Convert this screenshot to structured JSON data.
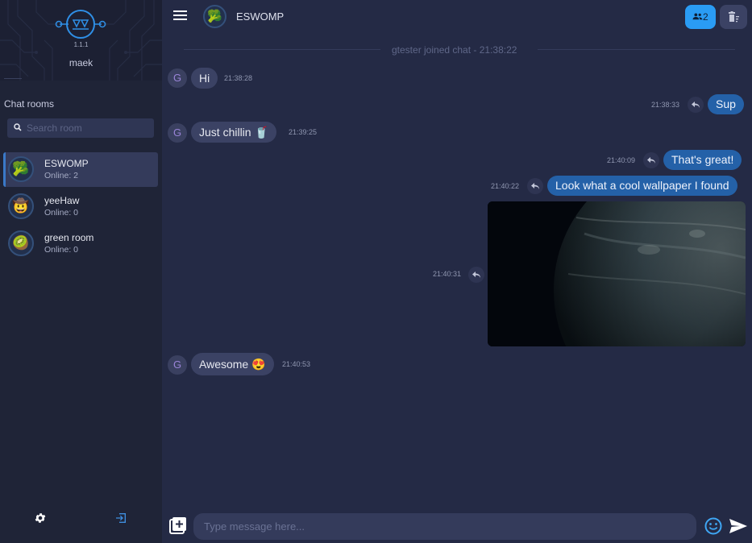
{
  "app": {
    "version": "1.1.1",
    "username": "maek"
  },
  "sidebar": {
    "rooms_title": "Chat rooms",
    "search_placeholder": "Search room",
    "rooms": [
      {
        "name": "ESWOMP",
        "online": "Online: 2",
        "avatar": "🥦",
        "active": true
      },
      {
        "name": "yeeHaw",
        "online": "Online: 0",
        "avatar": "🤠",
        "active": false
      },
      {
        "name": "green room",
        "online": "Online: 0",
        "avatar": "🥝",
        "active": false
      }
    ],
    "footer_icons": [
      "gear-icon",
      "logout-icon"
    ]
  },
  "header": {
    "room_name": "ESWOMP",
    "room_avatar": "🥦",
    "users_count": "2"
  },
  "messages": {
    "system": "gtester joined chat - 21:38:22",
    "items": [
      {
        "author": "G",
        "direction": "in",
        "text": "Hi",
        "emoji": "",
        "time": "21:38:28"
      },
      {
        "direction": "out",
        "text": "Sup",
        "time": "21:38:33"
      },
      {
        "author": "G",
        "direction": "in",
        "text": "Just chillin",
        "emoji": "🥤",
        "time": "21:39:25"
      },
      {
        "direction": "out",
        "text": "That's great!",
        "time": "21:40:09"
      },
      {
        "direction": "out",
        "text": "Look what a cool wallpaper I found",
        "time": "21:40:22"
      },
      {
        "direction": "out",
        "type": "image",
        "time": "21:40:31"
      },
      {
        "author": "G",
        "direction": "in",
        "text": "Awesome",
        "emoji": "😍",
        "time": "21:40:53"
      }
    ]
  },
  "composer": {
    "placeholder": "Type message here..."
  },
  "colors": {
    "background": "#242a45",
    "sidebar": "#1f2437",
    "accent": "#2a9cf4",
    "outgoing_bubble": "#2461a8",
    "incoming_bubble": "#3b4264"
  }
}
